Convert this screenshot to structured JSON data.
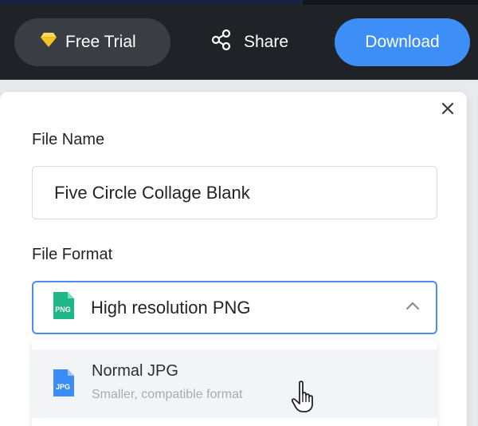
{
  "topbar": {
    "free_trial_label": "Free Trial",
    "share_label": "Share",
    "download_label": "Download"
  },
  "panel": {
    "file_name_label": "File Name",
    "file_name_value": "Five Circle Collage Blank",
    "file_format_label": "File Format",
    "selected_format": {
      "badge": "PNG",
      "label": "High resolution PNG"
    },
    "options": [
      {
        "badge": "JPG",
        "title": "Normal JPG",
        "subtitle": "Smaller, compatible format"
      }
    ]
  },
  "colors": {
    "topbar_bg": "#1f2227",
    "trial_btn_bg": "#3a3d43",
    "download_btn_bg": "#3d8ef7",
    "gem_icon": "#f7c325",
    "select_border": "#4a8ff0",
    "png_badge": "#21b58a",
    "jpg_badge": "#3b8cf5"
  },
  "icons": [
    "diamond-icon",
    "share-icon",
    "close-icon",
    "png-file-icon",
    "chevron-up-icon",
    "jpg-file-icon",
    "hand-cursor-icon"
  ]
}
